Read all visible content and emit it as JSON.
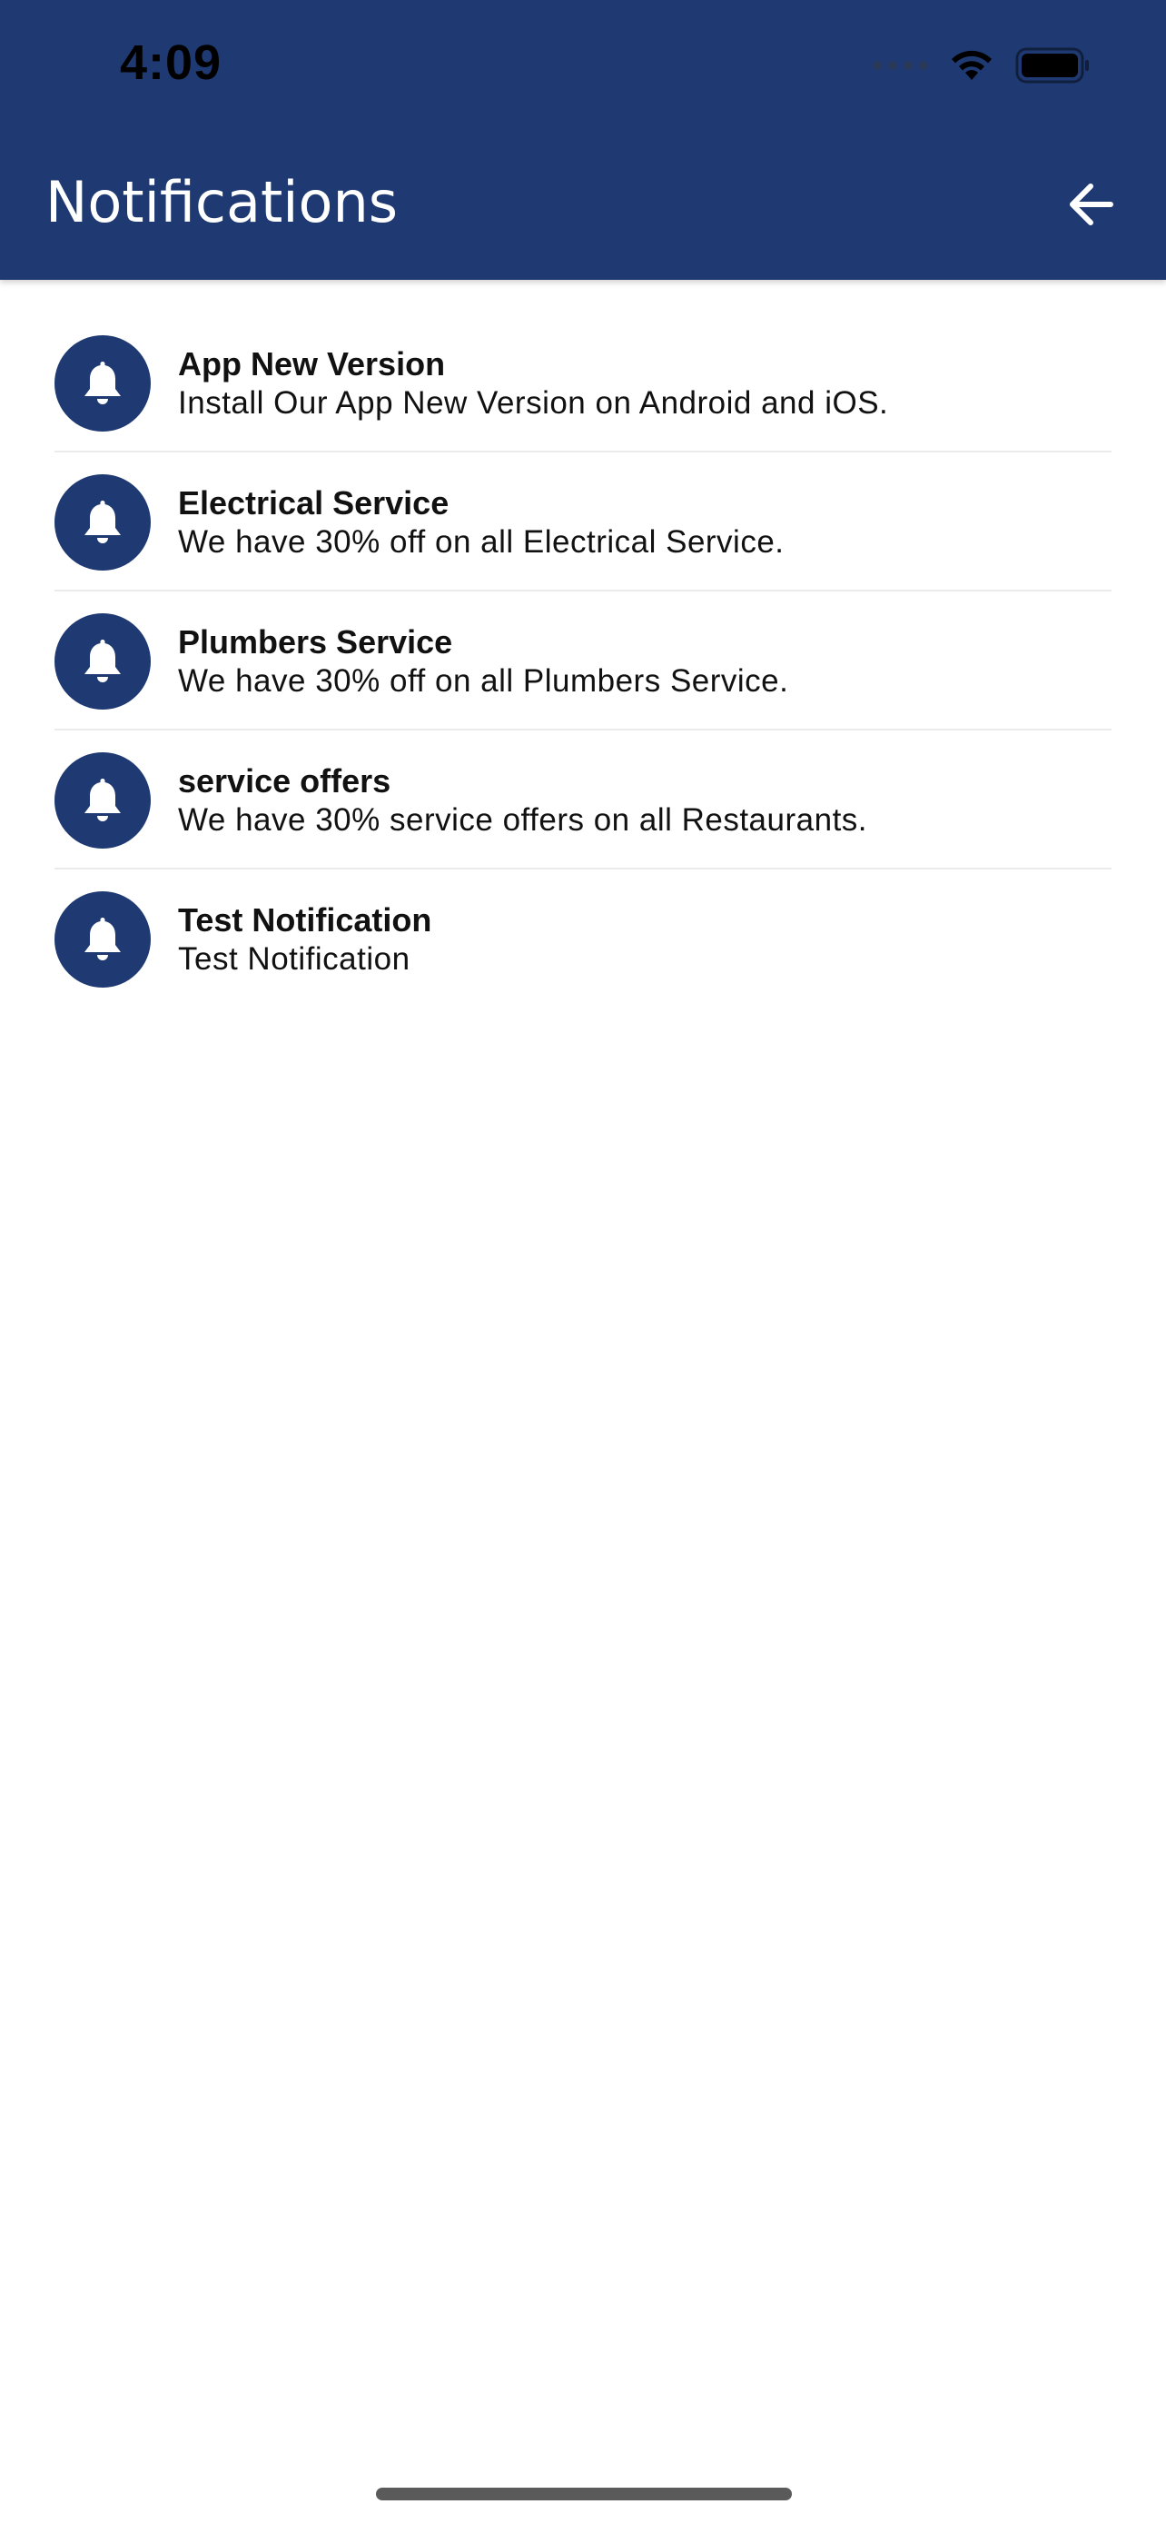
{
  "status_bar": {
    "time": "4:09"
  },
  "header": {
    "title": "Notifications",
    "back_icon": "arrow-left-icon",
    "background_color": "#1f3a72"
  },
  "notifications": [
    {
      "title": "App New Version",
      "body": "Install Our App New Version on Android and iOS.",
      "icon": "bell-icon"
    },
    {
      "title": "Electrical Service",
      "body": "We have 30% off on all Electrical Service.",
      "icon": "bell-icon"
    },
    {
      "title": "Plumbers Service",
      "body": "We have 30% off on all Plumbers Service.",
      "icon": "bell-icon"
    },
    {
      "title": "service offers",
      "body": "We have 30% service offers on all Restaurants.",
      "icon": "bell-icon"
    },
    {
      "title": "Test Notification",
      "body": "Test Notification",
      "icon": "bell-icon"
    }
  ]
}
